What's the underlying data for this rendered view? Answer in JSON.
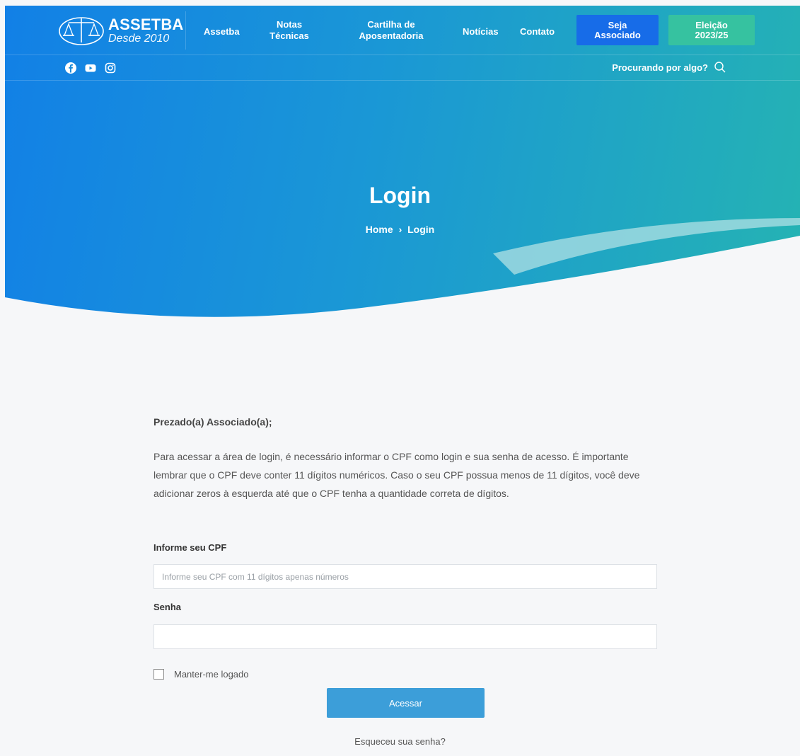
{
  "brand": {
    "name": "ASSETBA",
    "tagline": "Desde 2010"
  },
  "nav": {
    "assetba": "Assetba",
    "notas_1": "Notas",
    "notas_2": "Técnicas",
    "cartilha_1": "Cartilha de",
    "cartilha_2": "Aposentadoria",
    "noticias": "Notícias",
    "contato": "Contato",
    "associado_1": "Seja",
    "associado_2": "Associado",
    "eleicao_1": "Eleição",
    "eleicao_2": "2023/25"
  },
  "search": {
    "label": "Procurando por algo?"
  },
  "hero": {
    "title": "Login",
    "breadcrumb_home": "Home",
    "breadcrumb_sep": "›",
    "breadcrumb_current": "Login"
  },
  "form": {
    "greeting": "Prezado(a) Associado(a);",
    "intro": "Para acessar a área de login, é necessário informar o CPF como login e sua senha de acesso. É importante lembrar que o CPF deve conter 11 dígitos numéricos. Caso o seu CPF possua menos de 11 dígitos, você deve adicionar zeros à esquerda até que o CPF tenha a quantidade correta de dígitos.",
    "cpf_label": "Informe seu CPF",
    "cpf_placeholder": "Informe seu CPF com 11 dígitos apenas números",
    "senha_label": "Senha",
    "remember_label": "Manter-me logado",
    "submit_label": "Acessar",
    "forgot_label": "Esqueceu sua senha?"
  },
  "icons": {
    "social": [
      "facebook-icon",
      "youtube-icon",
      "instagram-icon"
    ],
    "search": "search-icon"
  },
  "colors": {
    "primary_blue": "#1280e6",
    "teal": "#25b3b3",
    "associado_button": "#176ce8",
    "eleicao_button": "#36c2a0",
    "submit_button": "#3c9ed9"
  }
}
